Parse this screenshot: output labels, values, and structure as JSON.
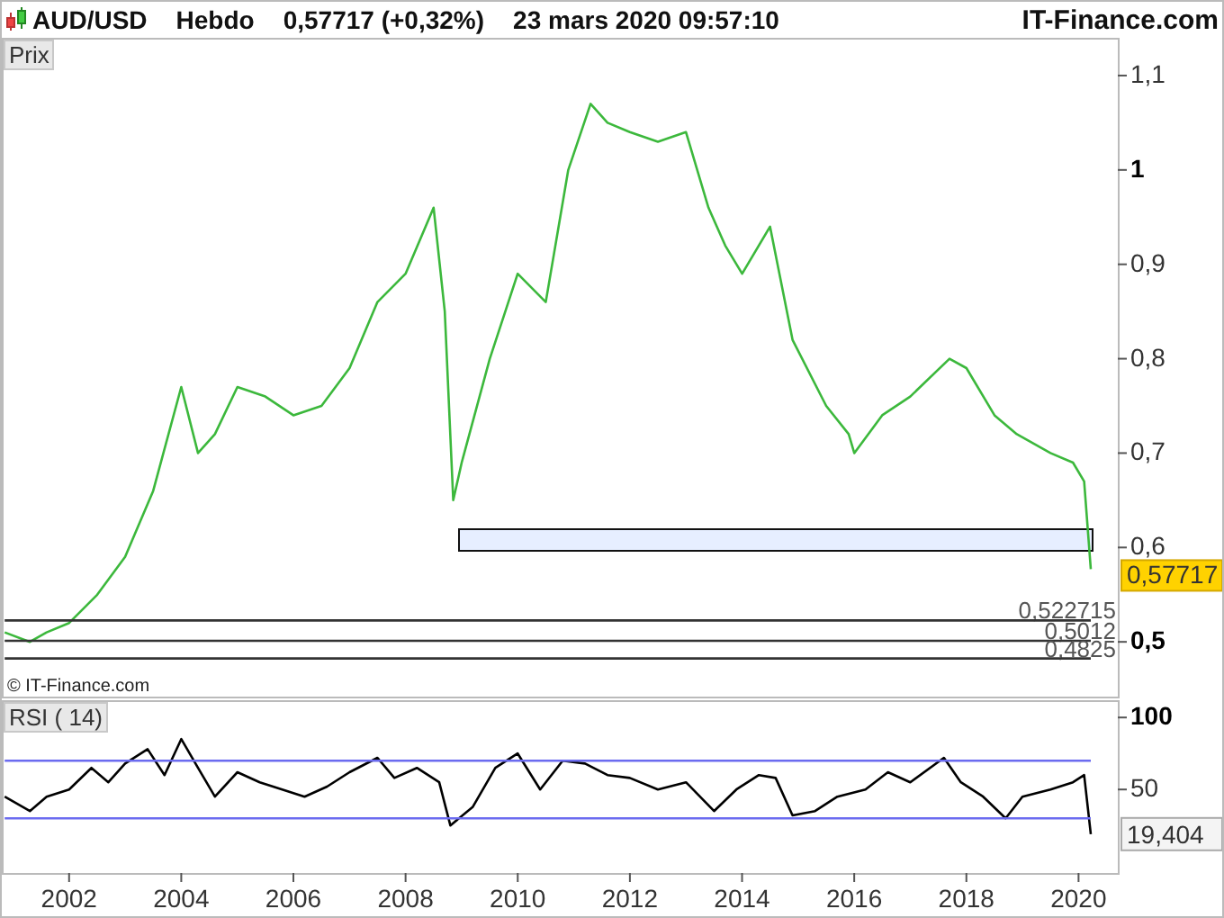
{
  "header": {
    "symbol": "AUD/USD",
    "period": "Hebdo",
    "quote": "0,57717 (+0,32%)",
    "datetime": "23 mars 2020 09:57:10",
    "brand": "IT-Finance.com"
  },
  "price_panel": {
    "label": "Prix",
    "copyright": "© IT-Finance.com",
    "last_price": "0,57717",
    "chart_data": {
      "type": "line",
      "x": [
        2000.85,
        2001.3,
        2001.6,
        2002,
        2002.5,
        2003,
        2003.5,
        2004,
        2004.3,
        2004.6,
        2005,
        2005.5,
        2006,
        2006.5,
        2007,
        2007.5,
        2008,
        2008.5,
        2008.7,
        2008.85,
        2009,
        2009.5,
        2010,
        2010.5,
        2010.9,
        2011.3,
        2011.6,
        2012,
        2012.5,
        2013,
        2013.4,
        2013.7,
        2014,
        2014.5,
        2014.9,
        2015.5,
        2015.9,
        2016,
        2016.5,
        2017,
        2017.7,
        2018,
        2018.5,
        2018.9,
        2019.5,
        2019.9,
        2020.1,
        2020.22
      ],
      "series": [
        {
          "color": "#3cb83c",
          "values": [
            0.51,
            0.5,
            0.51,
            0.52,
            0.55,
            0.59,
            0.66,
            0.77,
            0.7,
            0.72,
            0.77,
            0.76,
            0.74,
            0.75,
            0.79,
            0.86,
            0.89,
            0.96,
            0.85,
            0.65,
            0.69,
            0.8,
            0.89,
            0.86,
            1.0,
            1.07,
            1.05,
            1.04,
            1.03,
            1.04,
            0.96,
            0.92,
            0.89,
            0.94,
            0.82,
            0.75,
            0.72,
            0.7,
            0.74,
            0.76,
            0.8,
            0.79,
            0.74,
            0.72,
            0.7,
            0.69,
            0.67,
            0.577
          ]
        },
        {
          "name": "0,522715",
          "color": "#333333",
          "values": [
            0.522715,
            0.522715,
            0.522715,
            0.522715,
            0.522715,
            0.522715,
            0.522715,
            0.522715,
            0.522715,
            0.522715,
            0.522715,
            0.522715,
            0.522715,
            0.522715,
            0.522715,
            0.522715,
            0.522715,
            0.522715,
            0.522715,
            0.522715,
            0.522715,
            0.522715,
            0.522715,
            0.522715,
            0.522715,
            0.522715,
            0.522715,
            0.522715,
            0.522715,
            0.522715,
            0.522715,
            0.522715,
            0.522715,
            0.522715,
            0.522715,
            0.522715,
            0.522715,
            0.522715,
            0.522715,
            0.522715,
            0.522715,
            0.522715,
            0.522715,
            0.522715,
            0.522715,
            0.522715,
            0.522715,
            0.522715
          ]
        },
        {
          "name": "0,5012",
          "color": "#333333",
          "values": [
            0.5012,
            0.5012,
            0.5012,
            0.5012,
            0.5012,
            0.5012,
            0.5012,
            0.5012,
            0.5012,
            0.5012,
            0.5012,
            0.5012,
            0.5012,
            0.5012,
            0.5012,
            0.5012,
            0.5012,
            0.5012,
            0.5012,
            0.5012,
            0.5012,
            0.5012,
            0.5012,
            0.5012,
            0.5012,
            0.5012,
            0.5012,
            0.5012,
            0.5012,
            0.5012,
            0.5012,
            0.5012,
            0.5012,
            0.5012,
            0.5012,
            0.5012,
            0.5012,
            0.5012,
            0.5012,
            0.5012,
            0.5012,
            0.5012,
            0.5012,
            0.5012,
            0.5012,
            0.5012,
            0.5012,
            0.5012
          ]
        },
        {
          "name": "0,4825",
          "color": "#333333",
          "values": [
            0.4825,
            0.4825,
            0.4825,
            0.4825,
            0.4825,
            0.4825,
            0.4825,
            0.4825,
            0.4825,
            0.4825,
            0.4825,
            0.4825,
            0.4825,
            0.4825,
            0.4825,
            0.4825,
            0.4825,
            0.4825,
            0.4825,
            0.4825,
            0.4825,
            0.4825,
            0.4825,
            0.4825,
            0.4825,
            0.4825,
            0.4825,
            0.4825,
            0.4825,
            0.4825,
            0.4825,
            0.4825,
            0.4825,
            0.4825,
            0.4825,
            0.4825,
            0.4825,
            0.4825,
            0.4825,
            0.4825,
            0.4825,
            0.4825,
            0.4825,
            0.4825,
            0.4825,
            0.4825,
            0.4825,
            0.4825
          ]
        }
      ],
      "xlim": [
        2000.8,
        2020.7
      ],
      "ylim": [
        0.442,
        1.14
      ],
      "yticks": [
        {
          "value": 1.1,
          "label": "1,1"
        },
        {
          "value": 1,
          "label": "1"
        },
        {
          "value": 0.9,
          "label": "0,9"
        },
        {
          "value": 0.8,
          "label": "0,8"
        },
        {
          "value": 0.7,
          "label": "0,7"
        },
        {
          "value": 0.6,
          "label": "0,6"
        },
        {
          "value": 0.5,
          "label": "0,5"
        }
      ]
    }
  },
  "rsi_panel": {
    "label": "RSI ( 14)",
    "last_value": "19,404",
    "chart_data": {
      "type": "line",
      "x": [
        2000.85,
        2001.3,
        2001.6,
        2002,
        2002.4,
        2002.7,
        2003,
        2003.4,
        2003.7,
        2004,
        2004.3,
        2004.6,
        2005,
        2005.4,
        2005.8,
        2006.2,
        2006.6,
        2007,
        2007.5,
        2007.8,
        2008.2,
        2008.6,
        2008.8,
        2009.2,
        2009.6,
        2010,
        2010.4,
        2010.8,
        2011.2,
        2011.6,
        2012,
        2012.5,
        2013,
        2013.5,
        2013.9,
        2014.3,
        2014.6,
        2014.9,
        2015.3,
        2015.7,
        2016.2,
        2016.6,
        2017,
        2017.6,
        2017.9,
        2018.3,
        2018.7,
        2019,
        2019.5,
        2019.9,
        2020.1,
        2020.22
      ],
      "series": [
        {
          "color": "#000000",
          "values": [
            45,
            35,
            45,
            50,
            65,
            55,
            68,
            78,
            60,
            85,
            65,
            45,
            62,
            55,
            50,
            45,
            52,
            62,
            72,
            58,
            65,
            55,
            25,
            38,
            65,
            75,
            50,
            70,
            68,
            60,
            58,
            50,
            55,
            35,
            50,
            60,
            58,
            32,
            35,
            45,
            50,
            62,
            55,
            72,
            55,
            45,
            30,
            45,
            50,
            55,
            60,
            19
          ]
        },
        {
          "color": "#6b6bf0",
          "values": [
            70,
            70,
            70,
            70,
            70,
            70,
            70,
            70,
            70,
            70,
            70,
            70,
            70,
            70,
            70,
            70,
            70,
            70,
            70,
            70,
            70,
            70,
            70,
            70,
            70,
            70,
            70,
            70,
            70,
            70,
            70,
            70,
            70,
            70,
            70,
            70,
            70,
            70,
            70,
            70,
            70,
            70,
            70,
            70,
            70,
            70,
            70,
            70,
            70,
            70,
            70,
            70
          ]
        },
        {
          "color": "#6b6bf0",
          "values": [
            30,
            30,
            30,
            30,
            30,
            30,
            30,
            30,
            30,
            30,
            30,
            30,
            30,
            30,
            30,
            30,
            30,
            30,
            30,
            30,
            30,
            30,
            30,
            30,
            30,
            30,
            30,
            30,
            30,
            30,
            30,
            30,
            30,
            30,
            30,
            30,
            30,
            30,
            30,
            30,
            30,
            30,
            30,
            30,
            30,
            30,
            30,
            30,
            30,
            30,
            30,
            30
          ]
        }
      ],
      "xlim": [
        2000.8,
        2020.7
      ],
      "ylim": [
        -8,
        112
      ],
      "xticks": [
        2002,
        2004,
        2006,
        2008,
        2010,
        2012,
        2014,
        2016,
        2018,
        2020
      ],
      "yticks": [
        {
          "value": 100,
          "label": "100"
        },
        {
          "value": 50,
          "label": "50"
        }
      ]
    }
  }
}
